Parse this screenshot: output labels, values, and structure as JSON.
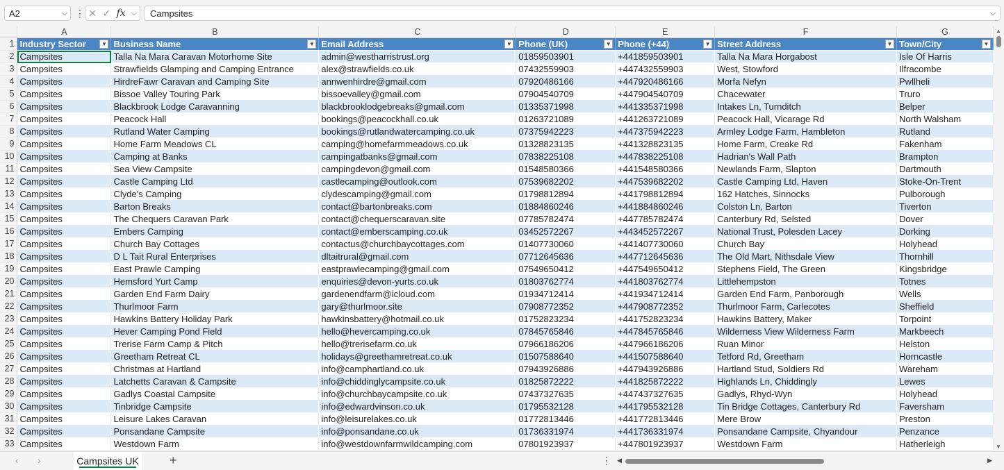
{
  "formula_bar": {
    "name_box": "A2",
    "formula": "Campsites",
    "fx_label": "fx",
    "cancel_glyph": "✕",
    "enter_glyph": "✓"
  },
  "columns": [
    "A",
    "B",
    "C",
    "D",
    "E",
    "F",
    "G"
  ],
  "headers": [
    "Industry Sector",
    "Business Name",
    "Email Address",
    "Phone (UK)",
    "Phone (+44)",
    "Street Address",
    "Town/City"
  ],
  "rows": [
    [
      "Campsites",
      "Talla Na Mara Caravan Motorhome Site",
      "admin@westharristrust.org",
      "01859503901",
      "+441859503901",
      "Talla Na Mara Horgabost",
      "Isle Of Harris"
    ],
    [
      "Campsites",
      "Strawfields Glamping and Camping Entrance",
      "alex@strawfields.co.uk",
      "07432559903",
      "+447432559903",
      "West, Stowford",
      "Ilfracombe"
    ],
    [
      "Campsites",
      "HirdreFawr Caravan and Camping Site",
      "annwenhirdre@gmail.com",
      "07920486166",
      "+447920486166",
      "Morfa Nefyn",
      "Pwllheli"
    ],
    [
      "Campsites",
      "Bissoe Valley Touring Park",
      "bissoevalley@gmail.com",
      "07904540709",
      "+447904540709",
      "Chacewater",
      "Truro"
    ],
    [
      "Campsites",
      "Blackbrook Lodge Caravanning",
      "blackbrooklodgebreaks@gmail.com",
      "01335371998",
      "+441335371998",
      "Intakes Ln, Turnditch",
      "Belper"
    ],
    [
      "Campsites",
      "Peacock Hall",
      "bookings@peacockhall.co.uk",
      "01263721089",
      "+441263721089",
      "Peacock Hall, Vicarage Rd",
      "North Walsham"
    ],
    [
      "Campsites",
      "Rutland Water Camping",
      "bookings@rutlandwatercamping.co.uk",
      "07375942223",
      "+447375942223",
      "Armley Lodge Farm, Hambleton",
      "Rutland"
    ],
    [
      "Campsites",
      "Home Farm Meadows CL",
      "camping@homefarmmeadows.co.uk",
      "01328823135",
      "+441328823135",
      "Home Farm, Creake Rd",
      "Fakenham"
    ],
    [
      "Campsites",
      "Camping at Banks",
      "campingatbanks@gmail.com",
      "07838225108",
      "+447838225108",
      "Hadrian's Wall Path",
      "Brampton"
    ],
    [
      "Campsites",
      "Sea View Campsite",
      "campingdevon@gmail.com",
      "01548580366",
      "+441548580366",
      "Newlands Farm, Slapton",
      "Dartmouth"
    ],
    [
      "Campsites",
      "Castle Camping Ltd",
      "castlecamping@outlook.com",
      "07539682202",
      "+447539682202",
      "Castle Camping Ltd, Haven",
      "Stoke-On-Trent"
    ],
    [
      "Campsites",
      "Clyde's Camping",
      "clydescamping@gmail.com",
      "01798812894",
      "+441798812894",
      "162 Hatches, Sinnocks",
      "Pulborough"
    ],
    [
      "Campsites",
      "Barton Breaks",
      "contact@bartonbreaks.com",
      "01884860246",
      "+441884860246",
      "Colston Ln, Barton",
      "Tiverton"
    ],
    [
      "Campsites",
      "The Chequers Caravan Park",
      "contact@chequerscaravan.site",
      "07785782474",
      "+447785782474",
      "Canterbury Rd, Selsted",
      "Dover"
    ],
    [
      "Campsites",
      "Embers Camping",
      "contact@emberscamping.co.uk",
      "03452572267",
      "+443452572267",
      "National Trust, Polesden Lacey",
      "Dorking"
    ],
    [
      "Campsites",
      "Church Bay Cottages",
      "contactus@churchbaycottages.com",
      "01407730060",
      "+441407730060",
      "Church Bay",
      "Holyhead"
    ],
    [
      "Campsites",
      "D L Tait Rural Enterprises",
      "dltaitrural@gmail.com",
      "07712645636",
      "+447712645636",
      "The Old Mart, Nithsdale View",
      "Thornhill"
    ],
    [
      "Campsites",
      "East Prawle Camping",
      "eastprawlecamping@gmail.com",
      "07549650412",
      "+447549650412",
      "Stephens Field, The Green",
      "Kingsbridge"
    ],
    [
      "Campsites",
      "Hemsford Yurt Camp",
      "enquiries@devon-yurts.co.uk",
      "01803762774",
      "+441803762774",
      "Littlehempston",
      "Totnes"
    ],
    [
      "Campsites",
      "Garden End Farm Dairy",
      "gardenendfarm@icloud.com",
      "01934712414",
      "+441934712414",
      "Garden End Farm, Panborough",
      "Wells"
    ],
    [
      "Campsites",
      "Thurlmoor Farm",
      "gary@thurlmoor.site",
      "07908772352",
      "+447908772352",
      "Thurlmoor Farm, Carlecotes",
      "Sheffield"
    ],
    [
      "Campsites",
      "Hawkins Battery Holiday Park",
      "hawkinsbattery@hotmail.co.uk",
      "01752823234",
      "+441752823234",
      "Hawkins Battery, Maker",
      "Torpoint"
    ],
    [
      "Campsites",
      "Hever Camping Pond Field",
      "hello@hevercamping.co.uk",
      "07845765846",
      "+447845765846",
      "Wilderness View Wilderness Farm",
      "Markbeech"
    ],
    [
      "Campsites",
      "Trerise Farm Camp & Pitch",
      "hello@trerisefarm.co.uk",
      "07966186206",
      "+447966186206",
      "Ruan Minor",
      "Helston"
    ],
    [
      "Campsites",
      "Greetham Retreat CL",
      "holidays@greethamretreat.co.uk",
      "01507588640",
      "+441507588640",
      "Tetford Rd, Greetham",
      "Horncastle"
    ],
    [
      "Campsites",
      "Christmas at Hartland",
      "info@camphartland.co.uk",
      "07943926886",
      "+447943926886",
      "Hartland Stud, Soldiers Rd",
      "Wareham"
    ],
    [
      "Campsites",
      "Latchetts Caravan & Campsite",
      "info@chiddinglycampsite.co.uk",
      "01825872222",
      "+441825872222",
      "Highlands Ln, Chiddingly",
      "Lewes"
    ],
    [
      "Campsites",
      "Gadlys Coastal Campsite",
      "info@churchbaycampsite.co.uk",
      "07437327635",
      "+447437327635",
      "Gadlys, Rhyd-Wyn",
      "Holyhead"
    ],
    [
      "Campsites",
      "Tinbridge Campsite",
      "info@edwardvinson.co.uk",
      "01795532128",
      "+441795532128",
      "Tin Bridge Cottages, Canterbury Rd",
      "Faversham"
    ],
    [
      "Campsites",
      "Leisure Lakes Caravan",
      "info@leisurelakes.co.uk",
      "01772813446",
      "+441772813446",
      "Mere Brow",
      "Preston"
    ],
    [
      "Campsites",
      "Ponsandane Campsite",
      "info@ponsandane.co.uk",
      "01736331974",
      "+441736331974",
      "Ponsandane Campsite, Chyandour",
      "Penzance"
    ],
    [
      "Campsites",
      "Westdown Farm",
      "info@westdownfarmwildcamping.com",
      "07801923937",
      "+447801923937",
      "Westdown Farm",
      "Hatherleigh"
    ]
  ],
  "sheet_tabs": [
    "Campsites UK"
  ],
  "add_sheet_glyph": "+"
}
